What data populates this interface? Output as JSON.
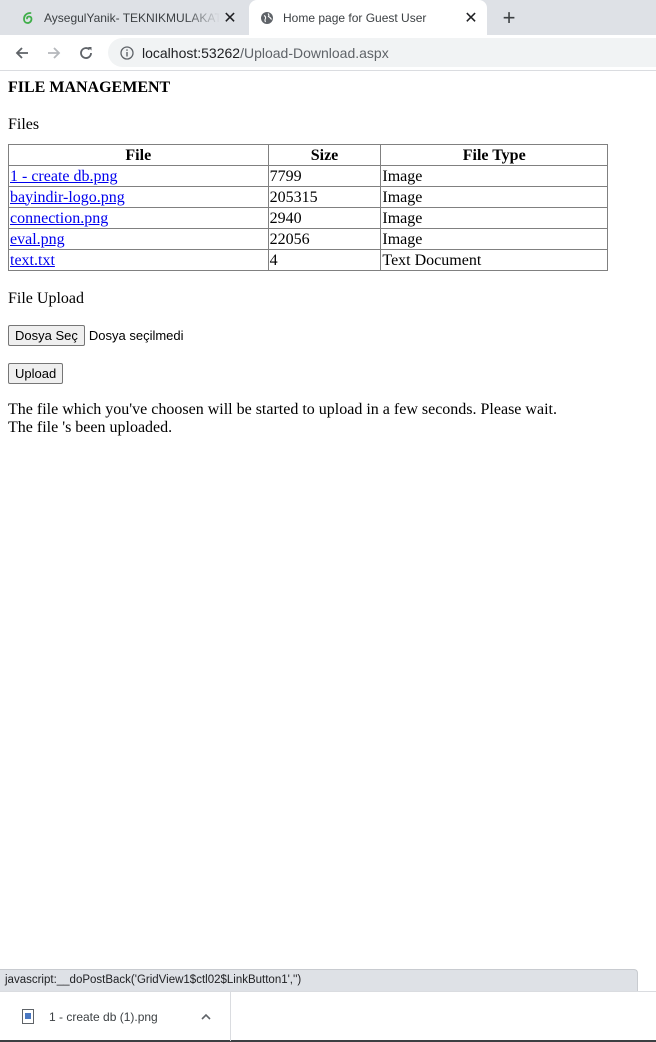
{
  "browser": {
    "tabs": [
      {
        "title": "AysegulYanik- TEKNIKMULAKATR",
        "icon": "green-leaf-icon",
        "active": false
      },
      {
        "title": "Home page for Guest User",
        "icon": "globe-icon",
        "active": true
      }
    ],
    "new_tab": "+",
    "url": {
      "host": "localhost:53262",
      "path": "/Upload-Download.aspx"
    }
  },
  "page": {
    "heading": "FILE MANAGEMENT",
    "files_label": "Files",
    "table": {
      "headers": [
        "File",
        "Size",
        "File Type"
      ],
      "rows": [
        {
          "file": "1 - create db.png",
          "size": "7799",
          "type": "Image"
        },
        {
          "file": "bayindir-logo.png",
          "size": "205315",
          "type": "Image"
        },
        {
          "file": "connection.png",
          "size": "2940",
          "type": "Image"
        },
        {
          "file": "eval.png",
          "size": "22056",
          "type": "Image"
        },
        {
          "file": "text.txt",
          "size": "4",
          "type": "Text Document"
        }
      ]
    },
    "upload_label": "File Upload",
    "choose_button": "Dosya Seç",
    "no_file_text": "Dosya seçilmedi",
    "upload_button": "Upload",
    "messages": [
      "The file which you've choosen will be started to upload in a few seconds. Please wait.",
      "The file 's been uploaded."
    ]
  },
  "status_bar": "javascript:__doPostBack('GridView1$ctl02$LinkButton1','')",
  "downloads": {
    "item_name": "1 - create db (1).png"
  },
  "colors": {
    "tabstrip": "#dee1e6",
    "link": "#0000ee",
    "omnibox": "#f1f3f4"
  }
}
